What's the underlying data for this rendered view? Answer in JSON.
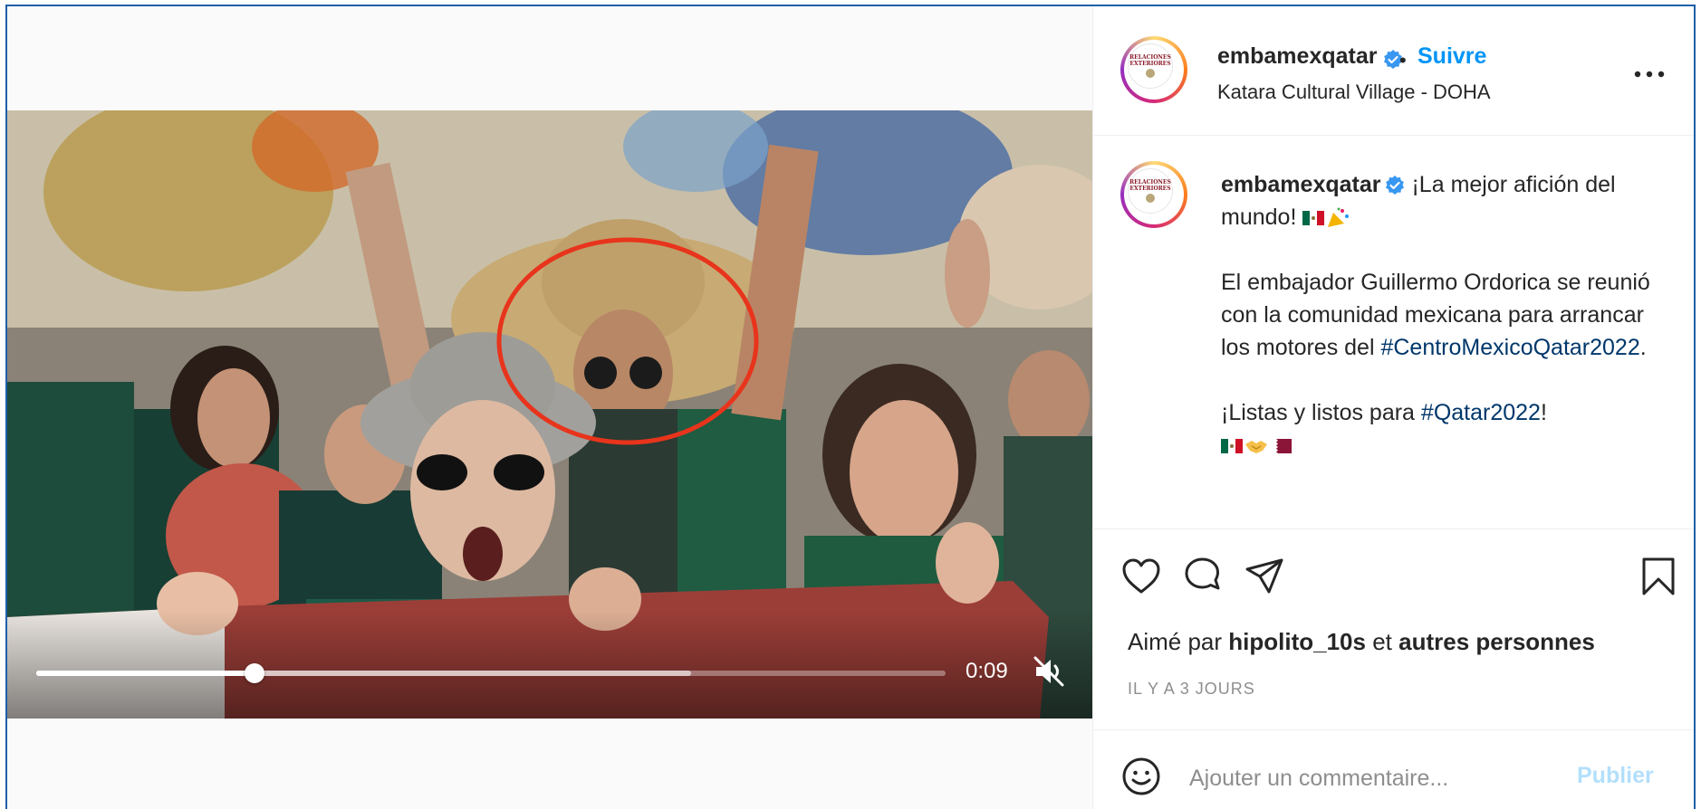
{
  "post": {
    "username": "embamexqatar",
    "verified": true,
    "separator": "•",
    "follow_label": "Suivre",
    "location": "Katara Cultural Village - DOHA",
    "more_label": "...",
    "avatar_text": [
      "RELACIONES",
      "EXTERIORES"
    ]
  },
  "caption": {
    "username": "embamexqatar",
    "line1": "¡La mejor afición del mundo! ",
    "paragraph2_pre": "El embajador Guillermo Ordorica se reunió con la comunidad mexicana para arrancar los motores del ",
    "hashtag1": "#CentroMexicoQatar2022",
    "paragraph2_post": ".",
    "paragraph3_pre": "¡Listas y listos para ",
    "hashtag2": "#Qatar2022",
    "paragraph3_post": "!",
    "emoji_line1": [
      "mexico-flag-emoji",
      "party-popper-emoji"
    ],
    "emoji_line2": [
      "mexico-flag-emoji",
      "handshake-emoji",
      "qatar-flag-emoji"
    ]
  },
  "video": {
    "current_time": "0:09",
    "progress_fraction": 0.24,
    "buffered_fraction": 0.72,
    "muted": true
  },
  "engagement": {
    "liked_by_prefix": "Aimé par ",
    "liked_by_user": "hipolito_10s",
    "liked_by_connector": " et ",
    "liked_by_others": "autres personnes",
    "time_ago": "IL Y A 3 JOURS"
  },
  "comment": {
    "placeholder": "Ajouter un commentaire...",
    "publish_label": "Publier"
  },
  "colors": {
    "accent": "#0095f6",
    "hashtag": "#00376b",
    "publish_disabled": "#b2dffc",
    "annotation_circle": "#e8341c"
  }
}
